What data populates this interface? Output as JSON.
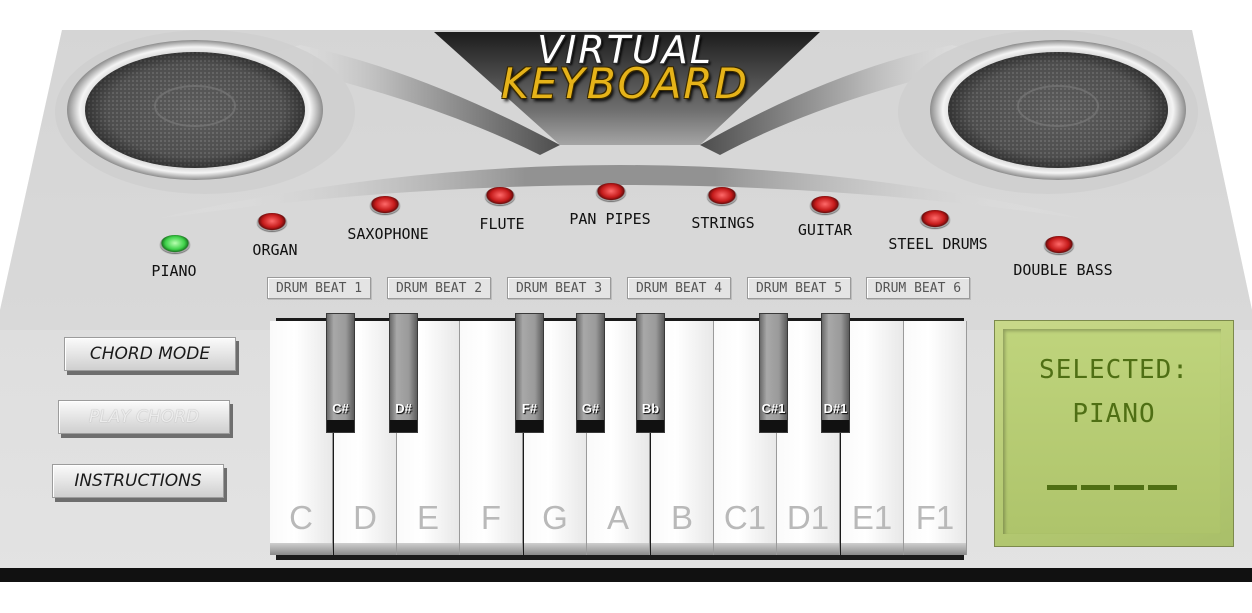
{
  "logo": {
    "line1": "VIRTUAL",
    "line2": "KEYBOARD"
  },
  "instruments": [
    {
      "label": "PIANO",
      "active": true
    },
    {
      "label": "ORGAN",
      "active": false
    },
    {
      "label": "SAXOPHONE",
      "active": false
    },
    {
      "label": "FLUTE",
      "active": false
    },
    {
      "label": "PAN PIPES",
      "active": false
    },
    {
      "label": "STRINGS",
      "active": false
    },
    {
      "label": "GUITAR",
      "active": false
    },
    {
      "label": "STEEL DRUMS",
      "active": false
    },
    {
      "label": "DOUBLE BASS",
      "active": false
    }
  ],
  "drum_beats": [
    "DRUM BEAT 1",
    "DRUM BEAT 2",
    "DRUM BEAT 3",
    "DRUM BEAT 4",
    "DRUM BEAT 5",
    "DRUM BEAT 6"
  ],
  "controls": {
    "chord_mode": "CHORD MODE",
    "play_chord": "PLAY CHORD",
    "instructions": "INSTRUCTIONS"
  },
  "white_keys": [
    "C",
    "D",
    "E",
    "F",
    "G",
    "A",
    "B",
    "C1",
    "D1",
    "E1",
    "F1"
  ],
  "black_keys": [
    "C#",
    "D#",
    "F#",
    "G#",
    "Bb",
    "C#1",
    "D#1"
  ],
  "display": {
    "line1": "SELECTED:",
    "line2": "PIANO"
  },
  "colors": {
    "led_active": "#3fd14a",
    "led_inactive": "#c41a1a",
    "logo_accent": "#e6b319",
    "lcd_text": "#4f6f14"
  }
}
